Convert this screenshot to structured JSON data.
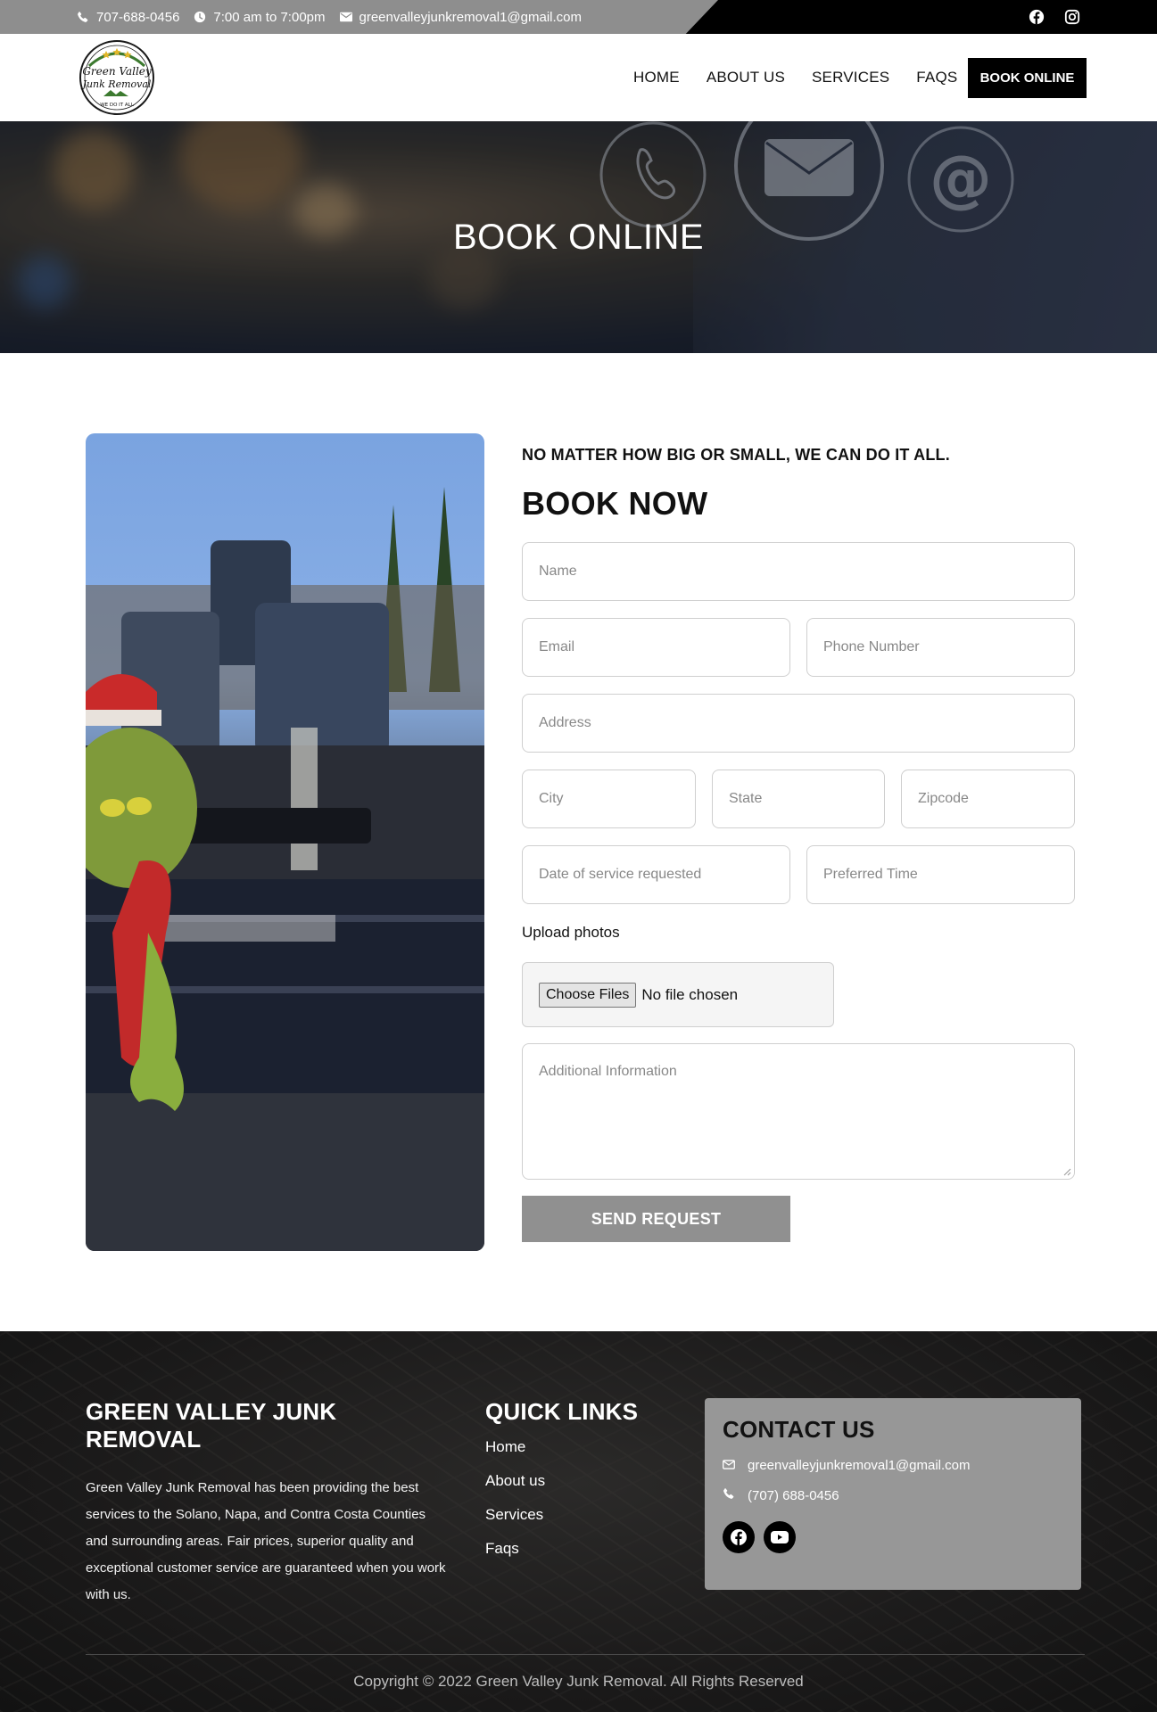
{
  "topbar": {
    "phone": "707-688-0456",
    "hours": "7:00 am to 7:00pm",
    "email": "greenvalleyjunkremoval1@gmail.com"
  },
  "logo": {
    "line1": "Green Valley",
    "line2": "Junk Removal",
    "tagline": "WE DO IT ALL"
  },
  "nav": {
    "items": [
      "HOME",
      "ABOUT US",
      "SERVICES",
      "FAQS"
    ],
    "cta": "BOOK ONLINE"
  },
  "hero": {
    "title": "BOOK ONLINE"
  },
  "form": {
    "tagline": "NO MATTER HOW BIG OR SMALL, WE CAN DO IT ALL.",
    "title": "BOOK NOW",
    "placeholders": {
      "name": "Name",
      "email": "Email",
      "phone": "Phone Number",
      "address": "Address",
      "city": "City",
      "state": "State",
      "zipcode": "Zipcode",
      "date": "Date of service requested",
      "time": "Preferred Time",
      "info": "Additional Information"
    },
    "upload_label": "Upload photos",
    "choose_files": "Choose Files",
    "no_file": "No file chosen",
    "submit": "SEND REQUEST"
  },
  "footer": {
    "about_title": "GREEN VALLEY JUNK REMOVAL",
    "about_text": "Green Valley Junk Removal has been providing the best services to the Solano, Napa, and Contra Costa Counties and surrounding areas. Fair prices, superior quality and exceptional customer service are guaranteed when you work with us.",
    "links_title": "QUICK LINKS",
    "links": [
      "Home",
      "About us",
      "Services",
      "Faqs"
    ],
    "contact_title": "CONTACT US",
    "contact_email": "greenvalleyjunkremoval1@gmail.com",
    "contact_phone": "(707) 688-0456",
    "copyright": "Copyright © 2022 Green Valley Junk Removal. All Rights Reserved"
  },
  "colors": {
    "topbar_grey": "#8e8e8e",
    "button_black": "#000000",
    "submit_grey": "#909090",
    "contact_card": "#979797"
  }
}
